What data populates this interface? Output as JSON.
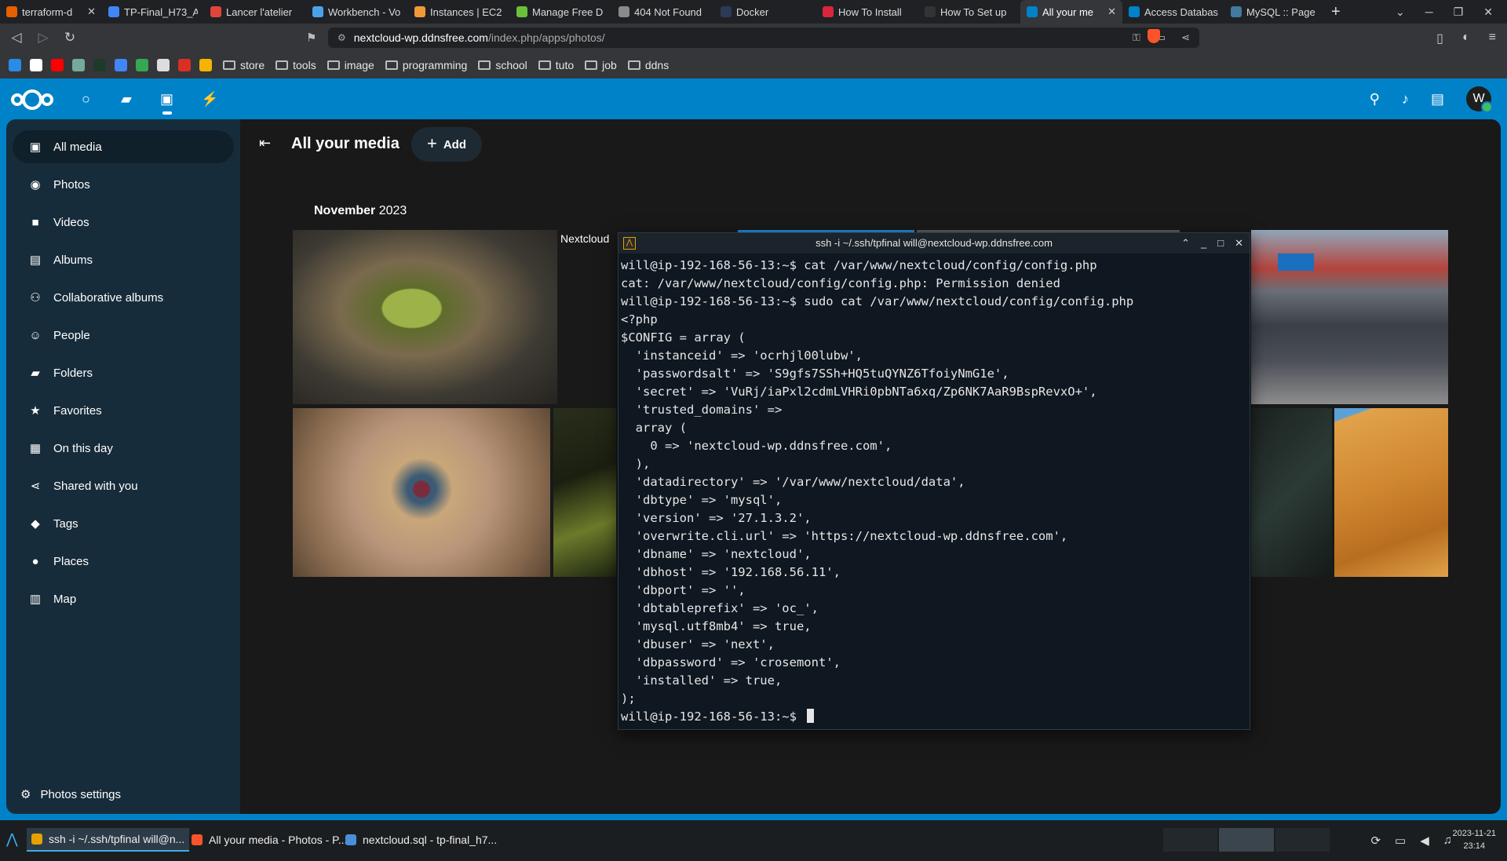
{
  "browser": {
    "tabs": [
      {
        "label": "terraform-d",
        "color": "#e66000",
        "active": false
      },
      {
        "label": "TP-Final_H73_A",
        "color": "#4285f4",
        "active": false
      },
      {
        "label": "Lancer l'atelier",
        "color": "#e0453a",
        "active": false
      },
      {
        "label": "Workbench - Vo",
        "color": "#4aa3e8",
        "active": false
      },
      {
        "label": "Instances | EC2",
        "color": "#f09a37",
        "active": false
      },
      {
        "label": "Manage Free D",
        "color": "#6bbf3b",
        "active": false
      },
      {
        "label": "404 Not Found",
        "color": "#8a8a8a",
        "active": false
      },
      {
        "label": "Docker",
        "color": "#2b3b55",
        "active": false
      },
      {
        "label": "How To Install",
        "color": "#d7263d",
        "active": false
      },
      {
        "label": "How To Set up",
        "color": "#333333",
        "active": false
      },
      {
        "label": "All your me",
        "color": "#0082c9",
        "active": true
      },
      {
        "label": "Access Databas",
        "color": "#0082c9",
        "active": false
      },
      {
        "label": "MySQL :: Page",
        "color": "#4479a1",
        "active": false
      }
    ],
    "url_host": "nextcloud-wp.ddnsfree.com",
    "url_path": "/index.php/apps/photos/",
    "bookmark_folders": [
      "store",
      "tools",
      "image",
      "programming",
      "school",
      "tuto",
      "job",
      "ddns"
    ]
  },
  "nextcloud": {
    "avatar_initial": "W",
    "sidebar": [
      {
        "label": "All media",
        "icon": "image-icon",
        "glyph": "▣",
        "active": true
      },
      {
        "label": "Photos",
        "icon": "camera-icon",
        "glyph": "◉",
        "active": false
      },
      {
        "label": "Videos",
        "icon": "video-icon",
        "glyph": "■",
        "active": false
      },
      {
        "label": "Albums",
        "icon": "album-icon",
        "glyph": "▤",
        "active": false
      },
      {
        "label": "Collaborative albums",
        "icon": "people-icon",
        "glyph": "⚇",
        "active": false
      },
      {
        "label": "People",
        "icon": "person-icon",
        "glyph": "☺",
        "active": false
      },
      {
        "label": "Folders",
        "icon": "folder-icon",
        "glyph": "▰",
        "active": false
      },
      {
        "label": "Favorites",
        "icon": "star-icon",
        "glyph": "★",
        "active": false
      },
      {
        "label": "On this day",
        "icon": "calendar-icon",
        "glyph": "▦",
        "active": false
      },
      {
        "label": "Shared with you",
        "icon": "share-icon",
        "glyph": "⋖",
        "active": false
      },
      {
        "label": "Tags",
        "icon": "tag-icon",
        "glyph": "◆",
        "active": false
      },
      {
        "label": "Places",
        "icon": "map-pin-icon",
        "glyph": "●",
        "active": false
      },
      {
        "label": "Map",
        "icon": "map-icon",
        "glyph": "▥",
        "active": false
      }
    ],
    "settings_label": "Photos settings",
    "page_title": "All your media",
    "add_label": "Add",
    "month_name": "November",
    "month_year": "2023",
    "nextcloud_label": "Nextcloud"
  },
  "terminal": {
    "title": "ssh -i ~/.ssh/tpfinal will@nextcloud-wp.ddnsfree.com",
    "lines": [
      "will@ip-192-168-56-13:~$ cat /var/www/nextcloud/config/config.php",
      "cat: /var/www/nextcloud/config/config.php: Permission denied",
      "will@ip-192-168-56-13:~$ sudo cat /var/www/nextcloud/config/config.php",
      "<?php",
      "$CONFIG = array (",
      "  'instanceid' => 'ocrhjl00lubw',",
      "  'passwordsalt' => 'S9gfs7SSh+HQ5tuQYNZ6TfoiyNmG1e',",
      "  'secret' => 'VuRj/iaPxl2cdmLVHRi0pbNTa6xq/Zp6NK7AaR9BspRevxO+',",
      "  'trusted_domains' =>",
      "  array (",
      "    0 => 'nextcloud-wp.ddnsfree.com',",
      "  ),",
      "  'datadirectory' => '/var/www/nextcloud/data',",
      "  'dbtype' => 'mysql',",
      "  'version' => '27.1.3.2',",
      "  'overwrite.cli.url' => 'https://nextcloud-wp.ddnsfree.com',",
      "  'dbname' => 'nextcloud',",
      "  'dbhost' => '192.168.56.11',",
      "  'dbport' => '',",
      "  'dbtableprefix' => 'oc_',",
      "  'mysql.utf8mb4' => true,",
      "  'dbuser' => 'next',",
      "  'dbpassword' => 'crosemont',",
      "  'installed' => true,",
      ");"
    ],
    "prompt": "will@ip-192-168-56-13:~$ "
  },
  "taskbar": {
    "items": [
      {
        "label": "ssh -i ~/.ssh/tpfinal will@n...",
        "color": "#e6a000",
        "active": true
      },
      {
        "label": "All your media - Photos - P...",
        "color": "#fb542b",
        "active": false
      },
      {
        "label": "nextcloud.sql - tp-final_h7...",
        "color": "#4a90d9",
        "active": false
      }
    ],
    "date": "2023-11-21",
    "time": "23:14"
  }
}
